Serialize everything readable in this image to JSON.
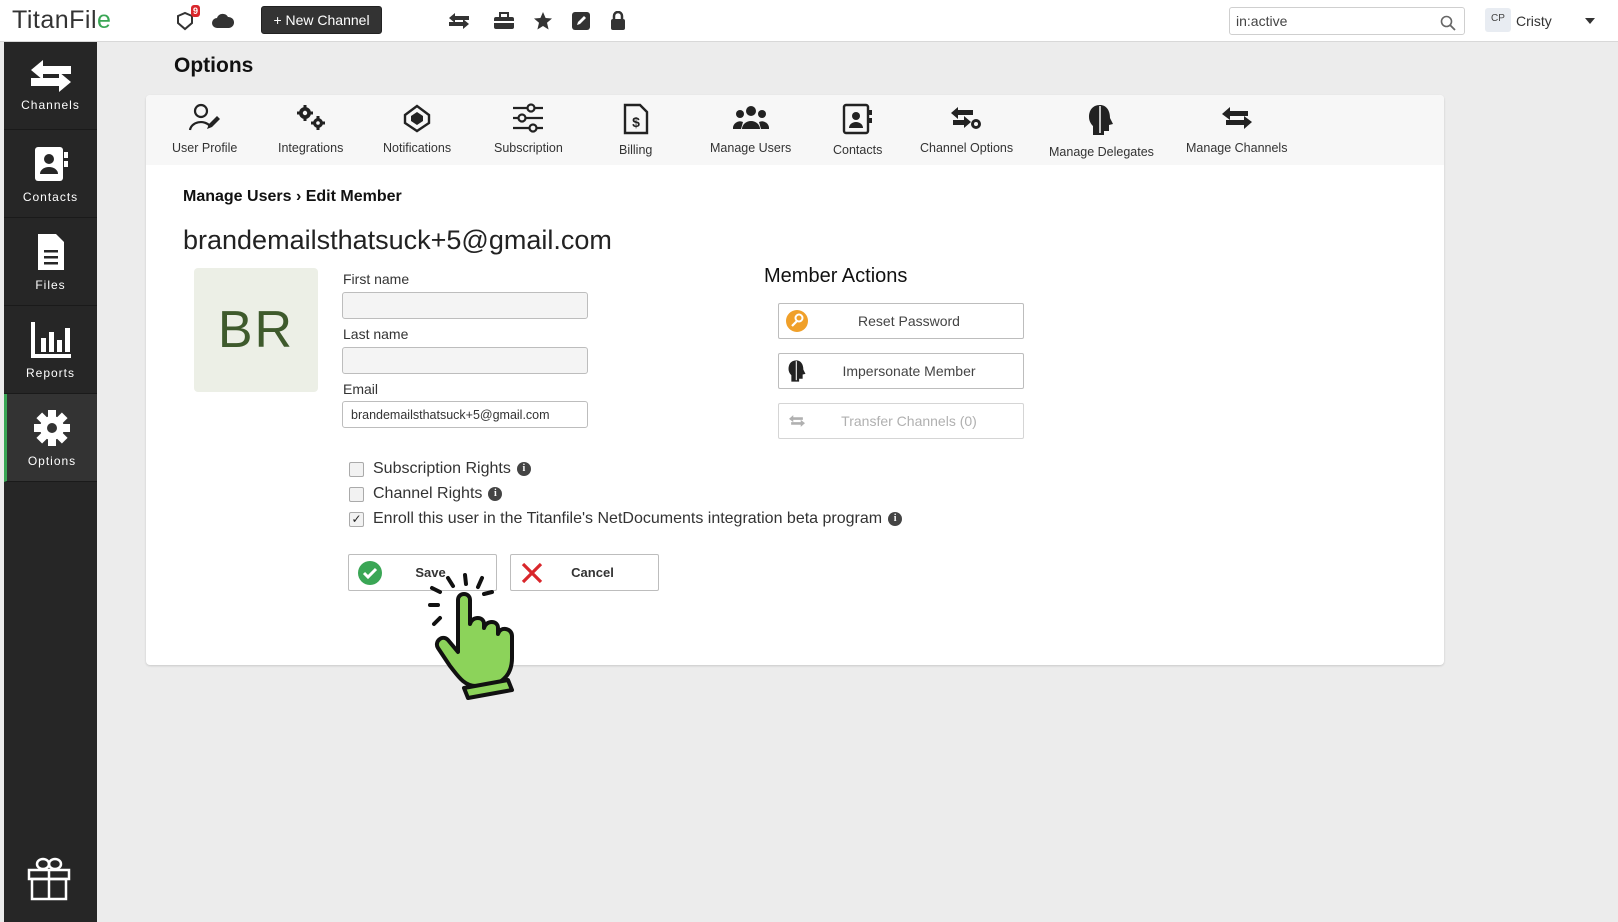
{
  "app": {
    "logo_text": "TitanFil",
    "logo_accent": "e"
  },
  "topbar": {
    "notification_count": "9",
    "new_channel_label": "+ New Channel",
    "search_value": "in:active",
    "user_initials": "CP",
    "user_name": "Cristy"
  },
  "sidebar": {
    "items": [
      {
        "label": "Channels",
        "icon": "channels-arrows-icon"
      },
      {
        "label": "Contacts",
        "icon": "contact-card-icon"
      },
      {
        "label": "Files",
        "icon": "file-icon"
      },
      {
        "label": "Reports",
        "icon": "bar-chart-icon"
      },
      {
        "label": "Options",
        "icon": "gear-icon",
        "active": true
      }
    ]
  },
  "page": {
    "title": "Options"
  },
  "tabs": [
    {
      "label": "User Profile"
    },
    {
      "label": "Integrations"
    },
    {
      "label": "Notifications"
    },
    {
      "label": "Subscription"
    },
    {
      "label": "Billing"
    },
    {
      "label": "Manage Users"
    },
    {
      "label": "Contacts"
    },
    {
      "label": "Channel Options"
    },
    {
      "label": "Manage Delegates"
    },
    {
      "label": "Manage Channels"
    }
  ],
  "member": {
    "breadcrumb_parent": "Manage Users",
    "breadcrumb_sep": " › ",
    "breadcrumb_current": "Edit Member",
    "email_heading": "brandemailsthatsuck+5@gmail.com",
    "avatar_initials": "BR",
    "first_name_label": "First name",
    "first_name_value": "",
    "last_name_label": "Last name",
    "last_name_value": "",
    "email_label": "Email",
    "email_value": "brandemailsthatsuck+5@gmail.com"
  },
  "actions": {
    "title": "Member Actions",
    "reset_password": "Reset Password",
    "impersonate": "Impersonate Member",
    "transfer": "Transfer Channels (0)"
  },
  "permissions": {
    "subscription_rights": {
      "label": "Subscription Rights",
      "checked": false
    },
    "channel_rights": {
      "label": "Channel Rights",
      "checked": false
    },
    "netdocuments_beta": {
      "label": "Enroll this user in the Titanfile's NetDocuments integration beta program",
      "checked": true
    }
  },
  "buttons": {
    "save": "Save",
    "cancel": "Cancel"
  },
  "colors": {
    "accent_green": "#3aa655",
    "sidebar_bg": "#262626",
    "cancel_red": "#d9262b",
    "key_orange": "#f0a02a"
  }
}
